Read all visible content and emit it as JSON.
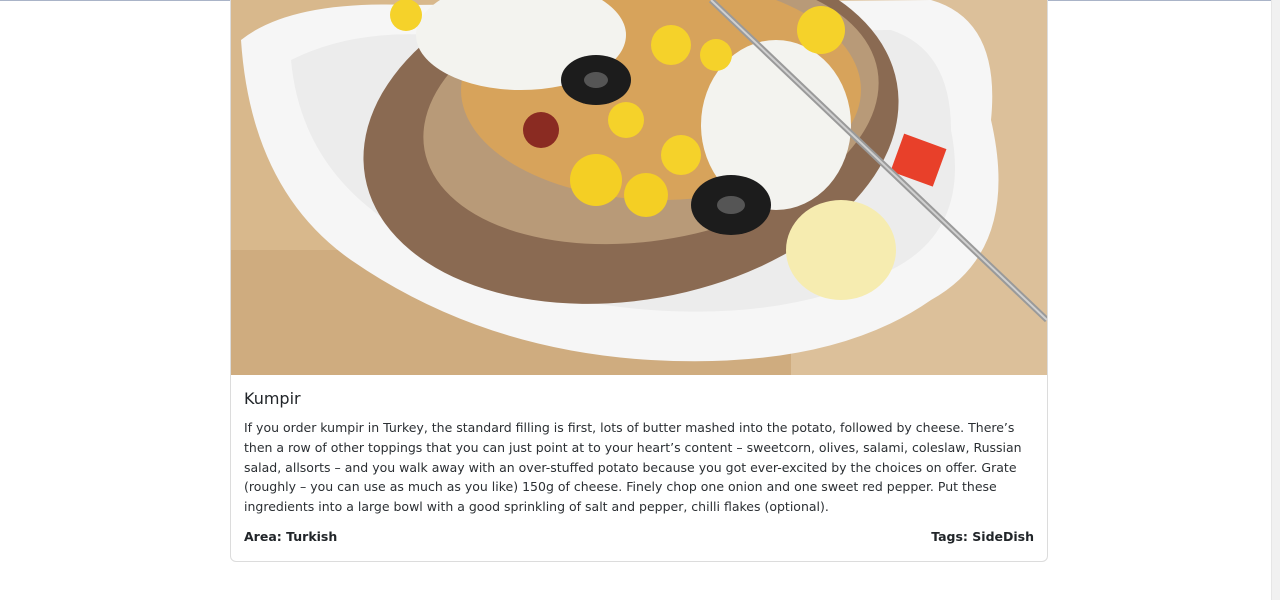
{
  "meal": {
    "title": "Kumpir",
    "description": "If you order kumpir in Turkey, the standard filling is first, lots of butter mashed into the potato, followed by cheese. There’s then a row of other toppings that you can just point at to your heart’s content – sweetcorn, olives, salami, coleslaw, Russian salad, allsorts – and you walk away with an over-stuffed potato because you got ever-excited by the choices on offer. Grate (roughly – you can use as much as you like) 150g of cheese. Finely chop one onion and one sweet red pepper. Put these ingredients into a large bowl with a good sprinkling of salt and pepper, chilli flakes (optional).",
    "area_text": "Area: Turkish",
    "tags_text": "Tags: SideDish"
  }
}
